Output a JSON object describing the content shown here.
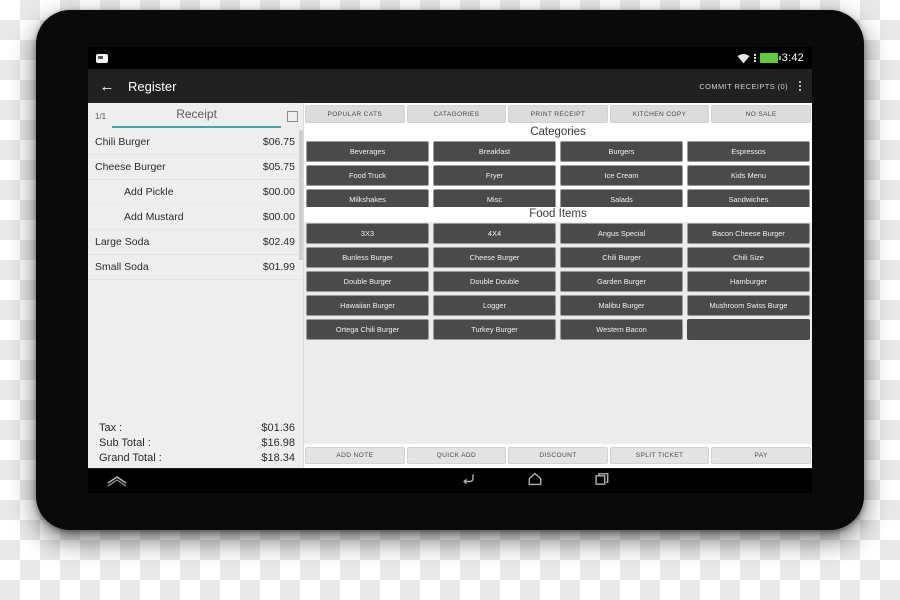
{
  "status_bar": {
    "notification_icon": "android-notification-icon",
    "wifi_icon": "wifi-icon",
    "battery_icon": "battery-full-icon",
    "clock": "3:42",
    "battery_color": "#5fcb3d"
  },
  "toolbar": {
    "back_icon": "arrow-left-icon",
    "title": "Register",
    "commit_label": "COMMIT RECEIPTS (0)",
    "overflow_icon": "more-vertical-icon",
    "background": "#212121"
  },
  "receipt": {
    "page_indicator": "1/1",
    "tab_label": "Receipt",
    "accent_color": "#3fa9a0",
    "select_all_checkbox": "checkbox-unchecked-icon",
    "items": [
      {
        "name": "Chili Burger",
        "price": "$06.75",
        "modifier": false
      },
      {
        "name": "Cheese Burger",
        "price": "$05.75",
        "modifier": false
      },
      {
        "name": "Add Pickle",
        "price": "$00.00",
        "modifier": true
      },
      {
        "name": "Add Mustard",
        "price": "$00.00",
        "modifier": true
      },
      {
        "name": "Large Soda",
        "price": "$02.49",
        "modifier": false
      },
      {
        "name": "Small Soda",
        "price": "$01.99",
        "modifier": false
      }
    ],
    "totals": [
      {
        "label": "Tax :",
        "value": "$01.36"
      },
      {
        "label": "Sub Total :",
        "value": "$16.98"
      },
      {
        "label": "Grand Total :",
        "value": "$18.34"
      }
    ]
  },
  "top_tabs": [
    {
      "label": "POPULAR CATS"
    },
    {
      "label": "CATAGORIES"
    },
    {
      "label": "PRINT RECEIPT"
    },
    {
      "label": "KITCHEN COPY"
    },
    {
      "label": "NO SALE"
    }
  ],
  "categories": {
    "title": "Categories",
    "buttons": [
      {
        "label": "Beverages"
      },
      {
        "label": "Breakfast"
      },
      {
        "label": "Burgers"
      },
      {
        "label": "Espressos"
      },
      {
        "label": "Food Truck"
      },
      {
        "label": "Fryer"
      },
      {
        "label": "Ice Cream"
      },
      {
        "label": "Kids Menu"
      },
      {
        "label": "Milkshakes"
      },
      {
        "label": "Misc"
      },
      {
        "label": "Salads"
      },
      {
        "label": "Sandwiches"
      }
    ]
  },
  "food_items": {
    "title": "Food Items",
    "buttons": [
      {
        "label": "3X3"
      },
      {
        "label": "4X4"
      },
      {
        "label": "Angus Special"
      },
      {
        "label": "Bacon Cheese Burger"
      },
      {
        "label": "Bunless Burger"
      },
      {
        "label": "Cheese Burger"
      },
      {
        "label": "Chili Burger"
      },
      {
        "label": "Chili Size"
      },
      {
        "label": "Double Burger"
      },
      {
        "label": "Double Double"
      },
      {
        "label": "Garden Burger"
      },
      {
        "label": "Hamburger"
      },
      {
        "label": "Hawaiian Burger"
      },
      {
        "label": "Logger"
      },
      {
        "label": "Malibu Burger"
      },
      {
        "label": "Mushroom Swiss Burge"
      },
      {
        "label": "Ortega Chili Burger"
      },
      {
        "label": "Turkey Burger"
      },
      {
        "label": "Western Bacon"
      },
      {
        "label": ""
      }
    ]
  },
  "bottom_tabs": [
    {
      "label": "ADD NOTE"
    },
    {
      "label": "QUICK ADD"
    },
    {
      "label": "DISCOUNT"
    },
    {
      "label": "SPLIT TICKET"
    },
    {
      "label": "PAY"
    }
  ],
  "nav_bar": {
    "reveal_icon": "chevron-up-icon",
    "back_icon": "back-arrow-icon",
    "home_icon": "home-icon",
    "recents_icon": "recents-icon"
  }
}
